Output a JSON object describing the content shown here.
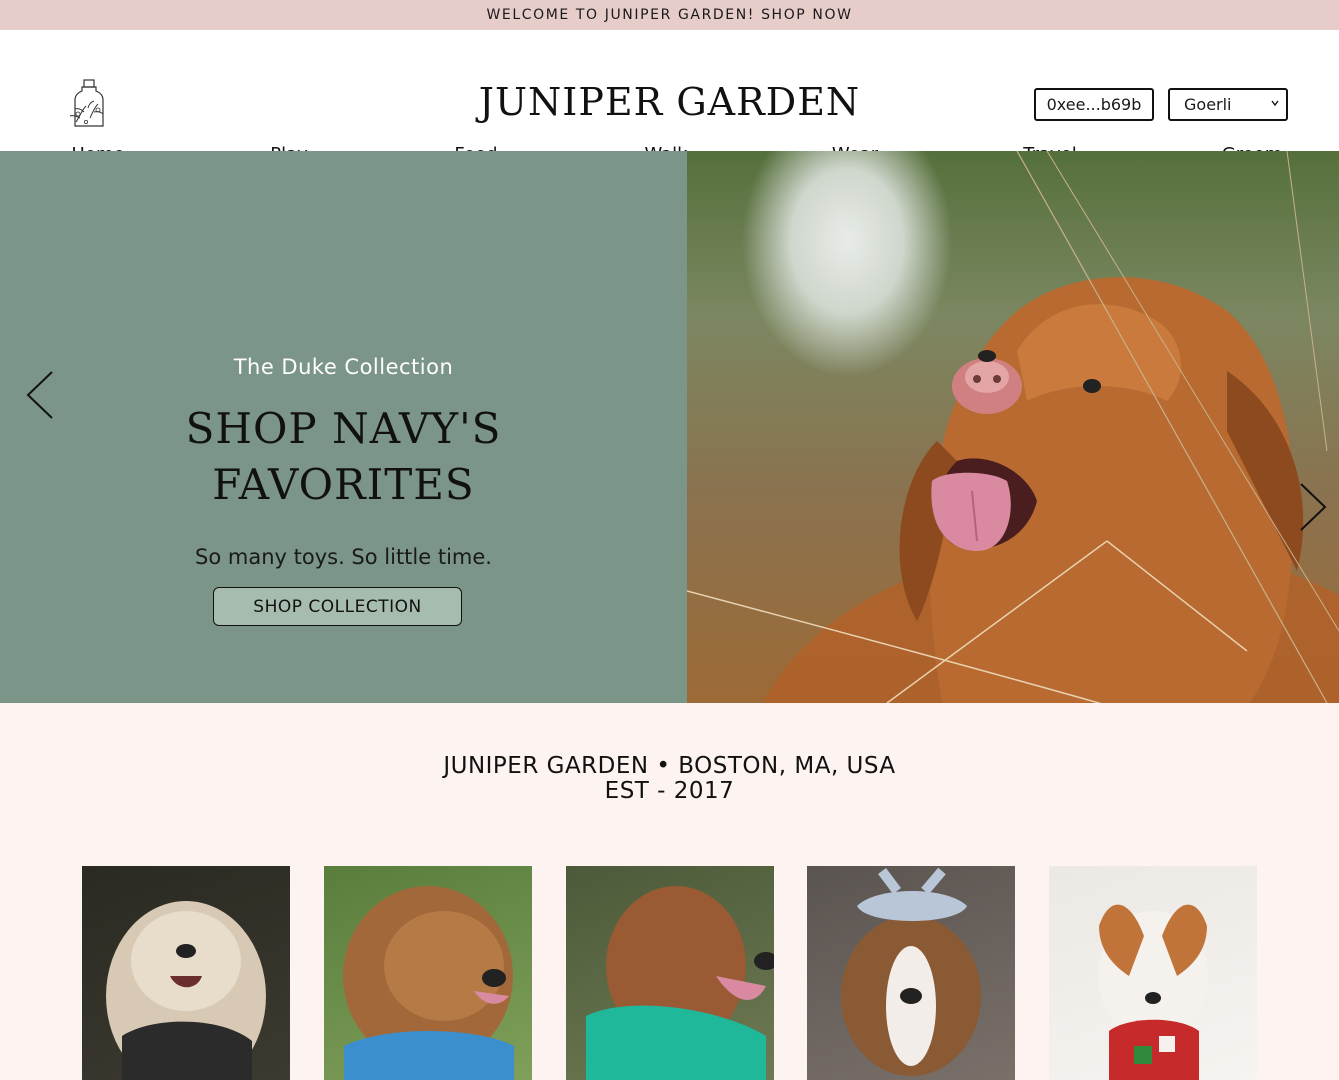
{
  "announcement": "WELCOME TO JUNIPER GARDEN! SHOP NOW",
  "header": {
    "brand": "JUNIPER GARDEN",
    "wallet_address": "0xee...b69b",
    "network_selected": "Goerli"
  },
  "nav": [
    "Home",
    "Play",
    "Food",
    "Walk",
    "Wear",
    "Travel",
    "Groom"
  ],
  "hero": {
    "subtitle": "The Duke Collection",
    "title_line1": "SHOP NAVY'S",
    "title_line2": "FAVORITES",
    "tagline": "So many toys. So little time.",
    "button": "SHOP COLLECTION"
  },
  "about": {
    "line1": "JUNIPER GARDEN • BOSTON, MA, USA",
    "line2": "EST - 2017"
  },
  "colors": {
    "announce_bg": "#e7cdca",
    "hero_green": "#7b9588",
    "button_green": "#a6bcae",
    "page_bg": "#fdf3f1"
  }
}
